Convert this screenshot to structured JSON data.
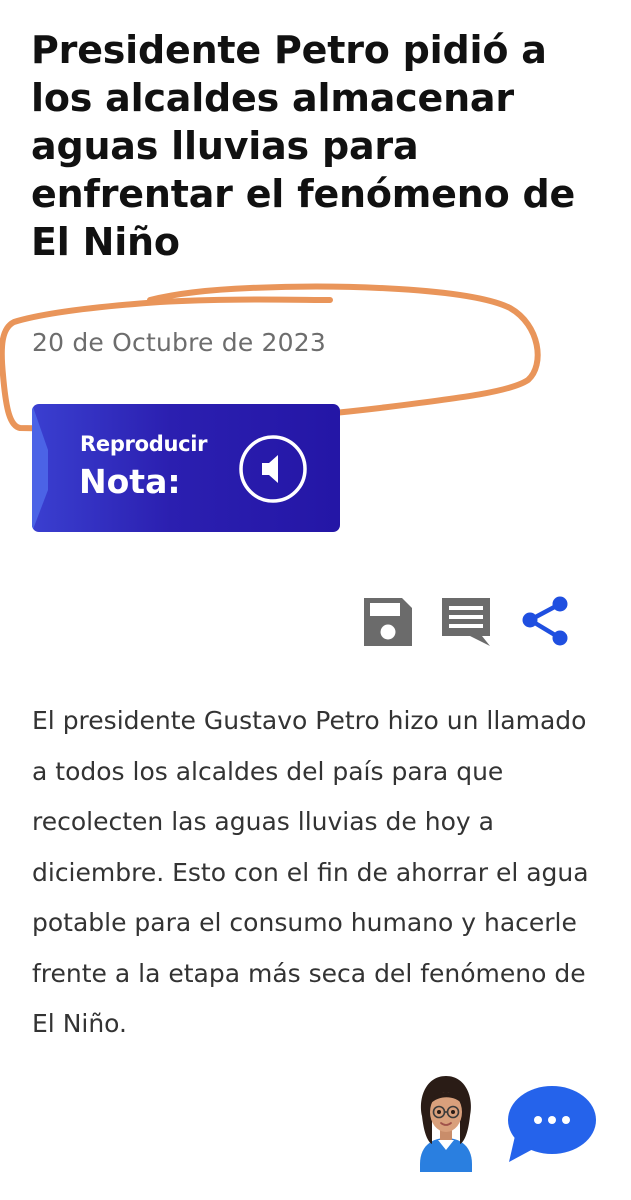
{
  "article": {
    "headline": "Presidente Petro pidió a los alcaldes almacenar aguas lluvias para enfrentar el fenómeno de El Niño",
    "date": "20 de Octubre de 2023",
    "body": "El presidente Gustavo Petro hizo un llamado a todos los alcaldes del país para que recolecten las aguas lluvias de hoy a diciembre. Esto con el fin de ahorrar el agua potable para el consumo humano y hacerle frente a la etapa más seca del fenómeno de El Niño."
  },
  "audio_player": {
    "label_line1": "Reproducir",
    "label_line2": "Nota:",
    "icon": "speaker-icon"
  },
  "actions": {
    "icons": [
      "save-icon",
      "comment-icon",
      "share-icon"
    ]
  },
  "floating": {
    "avatar_icon": "assistant-avatar",
    "chat_icon": "chat-bubble-icon"
  },
  "colors": {
    "annotation": "#e9955a",
    "audio_card": "#2b1fb0",
    "share": "#1f4fe0",
    "gray_icon": "#6b6b6b",
    "chat": "#2563eb"
  }
}
